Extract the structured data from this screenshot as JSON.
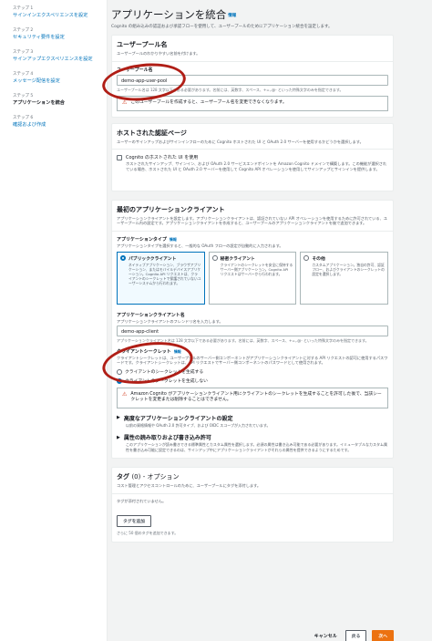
{
  "steps": [
    {
      "no": "ステップ 1",
      "label": "サインインエクスペリエンスを設定",
      "current": false
    },
    {
      "no": "ステップ 2",
      "label": "セキュリティ要件を設定",
      "current": false
    },
    {
      "no": "ステップ 3",
      "label": "サインアップエクスペリエンスを設定",
      "current": false
    },
    {
      "no": "ステップ 4",
      "label": "メッセージ配信を設定",
      "current": false
    },
    {
      "no": "ステップ 5",
      "label": "アプリケーションを統合",
      "current": true
    },
    {
      "no": "ステップ 6",
      "label": "確認および作成",
      "current": false
    }
  ],
  "header": {
    "title": "アプリケーションを統合",
    "info": "情報",
    "subtitle": "Cognito の組み込みの認証および承認フローを使用して、ユーザープールのためにアプリケーション統合を設定します。"
  },
  "user_pool": {
    "title": "ユーザープール名",
    "desc": "ユーザープールのわかりやすい名前を付けます。",
    "field_label": "ユーザープール名",
    "field_value": "demo-app-user-pool",
    "hint": "ユーザープール名は 128 文字以下である必要があります。名前には、英数字、スペース、+=,.@- といった特殊文字のみを指定できます。",
    "warning": "このユーザープールを作成すると、ユーザープール名を変更できなくなります。"
  },
  "hosted_ui": {
    "title": "ホストされた認証ページ",
    "desc": "ユーザーのサインアップおよびサインインフローのために Cognito ホストされた UI と OAuth 2.0 サーバーを使用するかどうかを選択します。",
    "checkbox_label": "Cognito のホストされた UI を使用",
    "checkbox_desc": "ホストされたサインアップ、サインイン、および OAuth 2.0 サービスエンドポイントを Amazon Cognito ドメインで構築します。この機能が選択されている場合、ホストされた UI と OAuth 2.0 サーバーを使用して Cognito API オペレーションを使用してサインアップとサインインを提供します。"
  },
  "app_client": {
    "title": "最初のアプリケーションクライアント",
    "desc": "アプリケーションクライアントを設定します。アプリケーションクライアントは、認証されていない API オペレーションを使用するために許可されている、ユーザープール内の設定です。アプリケーションクライアントを作成すると、ユーザープールのアプリケーションクライアントを後で追加できます。",
    "type_label": "アプリケーションタイプ",
    "type_info": "情報",
    "type_desc": "アプリケーションタイプを選択すると、一般的な OAuth フローの設定が自動的に入力されます。",
    "types": [
      {
        "name": "パブリッククライアント",
        "desc": "ネイティブアプリケーション、ブラウザアプリケーション、またはモバイルデバイスアプリケーション。Cognito API リクエストは、クライアントのシークレットで保護されていないユーザーシステムから行われます。",
        "selected": true
      },
      {
        "name": "秘密クライアント",
        "desc": "クライアントのシークレットを安全に保持するサーバー側アプリケーション。Cognito API リクエストはサーバーから行われます。",
        "selected": false
      },
      {
        "name": "その他",
        "desc": "カスタムアプリケーション。独自の許可、認証フロー、およびクライアントのシークレットの設定を選択します。",
        "selected": false
      }
    ],
    "client_label": "アプリケーションクライアント名",
    "client_desc": "アプリケーションクライアントのフレンドリ名を入力します。",
    "client_value": "demo-app-client",
    "client_hint": "アプリケーションクライアント名は 128 文字以下である必要があります。名前には、英数字、スペース、+=,.@- といった特殊文字のみを指定できます。",
    "secret_label": "クライアントシークレット",
    "secret_info": "情報",
    "secret_desc": "クライアントシークレットは、ユーザープールのサーバー側コンポーネントがアプリケーションクライアントに対する API リクエストの認可に使用するパスワードです。クライアントシークレットは、API リクエストでサーバー側コンポーネントのパスワードとして使用されます。",
    "secret_options": [
      {
        "label": "クライアントのシークレットを生成する",
        "selected": false
      },
      {
        "label": "クライアントのシークレットを生成しない",
        "selected": true
      }
    ],
    "secret_warning": "Amazon Cognito がアプリケーションクライアント用にクライアントのシークレットを生成することを許可した後で、当該シークレットを変更または削除することはできません。",
    "advanced_title": "高度なアプリケーションクライアントの設定",
    "advanced_desc": "以前の資格情報や OAuth 2.0 許可タイプ、および OIDC スコープが入力されています。",
    "attr_title": "属性の読み取りおよび書き込み許可",
    "attr_desc": "このアプリケーションが読み書きできる標準属性とカスタム属性を選択します。必須の属性は書き込み可能である必要があります。イミュータブルなカスタム属性を書き込み可能に設定できるのは、サインアップ中にアプリケーションクライアントがそれらの属性を提供できるようにするためです。"
  },
  "tags": {
    "title": "タグ",
    "count": "(0)",
    "optional": "- オプション",
    "desc": "コスト管理とアクセスコントロールのために、ユーザープールにタグを添付します。",
    "empty": "タグが添付されていません。",
    "add_button": "タグを追加",
    "hint": "さらに 50 個のタグを追加できます。"
  },
  "footer": {
    "cancel": "キャンセル",
    "back": "戻る",
    "next": "次へ"
  }
}
